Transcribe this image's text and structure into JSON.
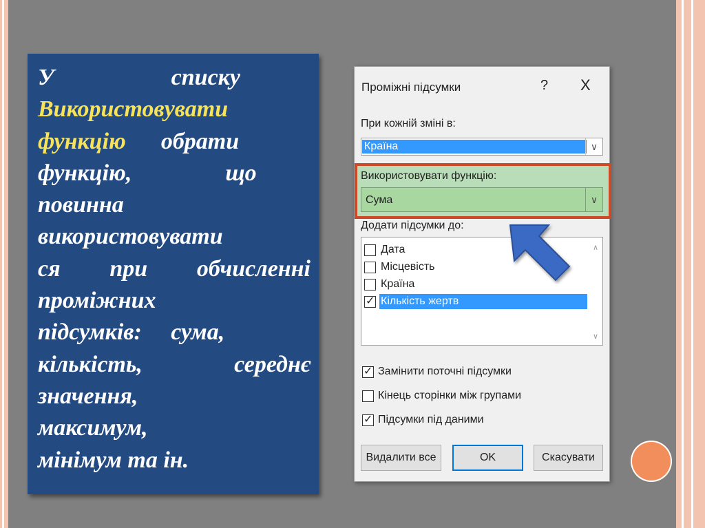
{
  "slide_text": {
    "lines": [
      {
        "segments": [
          {
            "text": "У                    списку",
            "highlight": false
          }
        ],
        "justify": false
      },
      {
        "segments": [
          {
            "text": "Використовувати",
            "highlight": true
          }
        ],
        "justify": false
      },
      {
        "segments": [
          {
            "text": "функцію",
            "highlight": true
          },
          {
            "text": "      обрати",
            "highlight": false
          }
        ],
        "justify": false
      },
      {
        "segments": [
          {
            "text": "функцію,                що",
            "highlight": false
          }
        ],
        "justify": false
      },
      {
        "segments": [
          {
            "text": "повинна",
            "highlight": false
          }
        ],
        "justify": false
      },
      {
        "segments": [
          {
            "text": "використовувати",
            "highlight": false
          }
        ],
        "justify": false
      },
      {
        "segments": [
          {
            "text": "ся при обчисленні",
            "highlight": false
          }
        ],
        "justify": true
      },
      {
        "segments": [
          {
            "text": "проміжних",
            "highlight": false
          }
        ],
        "justify": false
      },
      {
        "segments": [
          {
            "text": "підсумків:     сума,",
            "highlight": false
          }
        ],
        "justify": false
      },
      {
        "segments": [
          {
            "text": "кількість, середнє",
            "highlight": false
          }
        ],
        "justify": true
      },
      {
        "segments": [
          {
            "text": "значення,",
            "highlight": false
          }
        ],
        "justify": false
      },
      {
        "segments": [
          {
            "text": "максимум,",
            "highlight": false
          }
        ],
        "justify": false
      },
      {
        "segments": [
          {
            "text": "мінімум та ін.",
            "highlight": false
          }
        ],
        "justify": false
      }
    ]
  },
  "dialog": {
    "title": "Проміжні підсумки",
    "help_label": "?",
    "close_label": "X",
    "change_label": "При кожній зміні в:",
    "change_value": "Країна",
    "function_label": "Використовувати функцію:",
    "function_value": "Сума",
    "add_label": "Додати підсумки до:",
    "fields": [
      {
        "label": "Дата",
        "checked": false,
        "selected": false
      },
      {
        "label": "Місцевість",
        "checked": false,
        "selected": false
      },
      {
        "label": "Країна",
        "checked": false,
        "selected": false
      },
      {
        "label": "Кількість жертв",
        "checked": true,
        "selected": true
      }
    ],
    "options": [
      {
        "label": "Замінити поточні підсумки",
        "checked": true
      },
      {
        "label": "Кінець сторінки між групами",
        "checked": false
      },
      {
        "label": "Підсумки під даними",
        "checked": true
      }
    ],
    "buttons": {
      "remove_all": "Видалити все",
      "ok": "OK",
      "cancel": "Скасувати"
    }
  },
  "colors": {
    "text_box_bg": "#244a82",
    "highlight_text": "#f7e35a",
    "annotation_border": "#cc4a26",
    "arrow": "#3a6bc4"
  },
  "icons": {
    "dropdown": "chevron-down-icon",
    "pointer": "arrow-icon"
  }
}
